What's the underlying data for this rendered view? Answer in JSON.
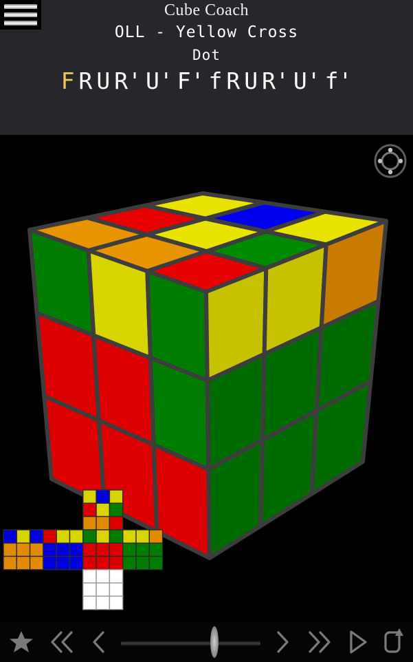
{
  "header": {
    "menu_icon": "hamburger-menu-icon",
    "app_title": "Cube Coach",
    "case_group": "OLL - Yellow Cross",
    "case_name": "Dot",
    "moves": [
      {
        "label": "F",
        "current": true
      },
      {
        "label": "R",
        "current": false
      },
      {
        "label": "U",
        "current": false
      },
      {
        "label": "R'",
        "current": false
      },
      {
        "label": "U'",
        "current": false
      },
      {
        "label": "F'",
        "current": false
      },
      {
        "label": "f",
        "current": false
      },
      {
        "label": "R",
        "current": false
      },
      {
        "label": "U",
        "current": false
      },
      {
        "label": "R'",
        "current": false
      },
      {
        "label": "U'",
        "current": false
      },
      {
        "label": "f'",
        "current": false
      }
    ],
    "current_move_color": "#edc75a",
    "background": "#26262b"
  },
  "stage": {
    "background": "#000000",
    "orientation_gizmo": "orientation-gizmo-icon"
  },
  "palette": {
    "yellow": "#d8d400",
    "yellow_light": "#e8e400",
    "red": "#dd0000",
    "red_dark": "#c40000",
    "blue": "#0000dd",
    "green": "#007d00",
    "green_dark": "#006b00",
    "orange": "#e08b00",
    "orange_dark": "#c97b00",
    "white": "#ffffff",
    "edge": "#3d3d3d",
    "net_border": "#2b2b2b"
  },
  "cube_3d": {
    "top_face": [
      [
        "orange",
        "red",
        "yellow"
      ],
      [
        "orange",
        "yellow",
        "blue"
      ],
      [
        "red",
        "green",
        "yellow"
      ]
    ],
    "left_face": [
      [
        "green",
        "yellow",
        "green"
      ],
      [
        "red",
        "red",
        "green"
      ],
      [
        "red",
        "red",
        "red"
      ]
    ],
    "right_face": [
      [
        "yellow",
        "yellow",
        "orange"
      ],
      [
        "green",
        "green",
        "green"
      ],
      [
        "green",
        "green",
        "green"
      ]
    ]
  },
  "net": {
    "faces": {
      "left": [
        [
          "blue",
          "yellow",
          "blue"
        ],
        [
          "orange",
          "orange",
          "orange"
        ],
        [
          "orange",
          "orange",
          "orange"
        ]
      ],
      "back": [
        [
          "red",
          "yellow",
          "yellow"
        ],
        [
          "blue",
          "blue",
          "blue"
        ],
        [
          "blue",
          "blue",
          "blue"
        ]
      ],
      "up": [
        [
          "yellow",
          "blue",
          "yellow"
        ],
        [
          "red",
          "yellow",
          "green"
        ],
        [
          "orange",
          "orange",
          "red"
        ]
      ],
      "front": [
        [
          "green",
          "yellow",
          "green"
        ],
        [
          "red",
          "red",
          "red"
        ],
        [
          "red",
          "red",
          "red"
        ]
      ],
      "right": [
        [
          "yellow",
          "yellow",
          "orange"
        ],
        [
          "green",
          "green",
          "green"
        ],
        [
          "green",
          "green",
          "green"
        ]
      ],
      "down": [
        [
          "white",
          "white",
          "white"
        ],
        [
          "white",
          "white",
          "white"
        ],
        [
          "white",
          "white",
          "white"
        ]
      ]
    }
  },
  "toolbar": {
    "background": "#050505",
    "icon_color": "#7a7a7a",
    "buttons": [
      {
        "name": "favorite-star-button",
        "icon": "star-icon"
      },
      {
        "name": "skip-back-button",
        "icon": "double-chevron-left-icon"
      },
      {
        "name": "step-back-button",
        "icon": "chevron-left-icon"
      },
      {
        "name": "step-forward-button",
        "icon": "chevron-right-icon"
      },
      {
        "name": "skip-forward-button",
        "icon": "double-chevron-right-icon"
      },
      {
        "name": "play-button",
        "icon": "play-triangle-icon"
      },
      {
        "name": "reset-loop-button",
        "icon": "loop-arrow-icon"
      }
    ],
    "slider": {
      "name": "progress-slider",
      "position_percent": 67
    }
  }
}
